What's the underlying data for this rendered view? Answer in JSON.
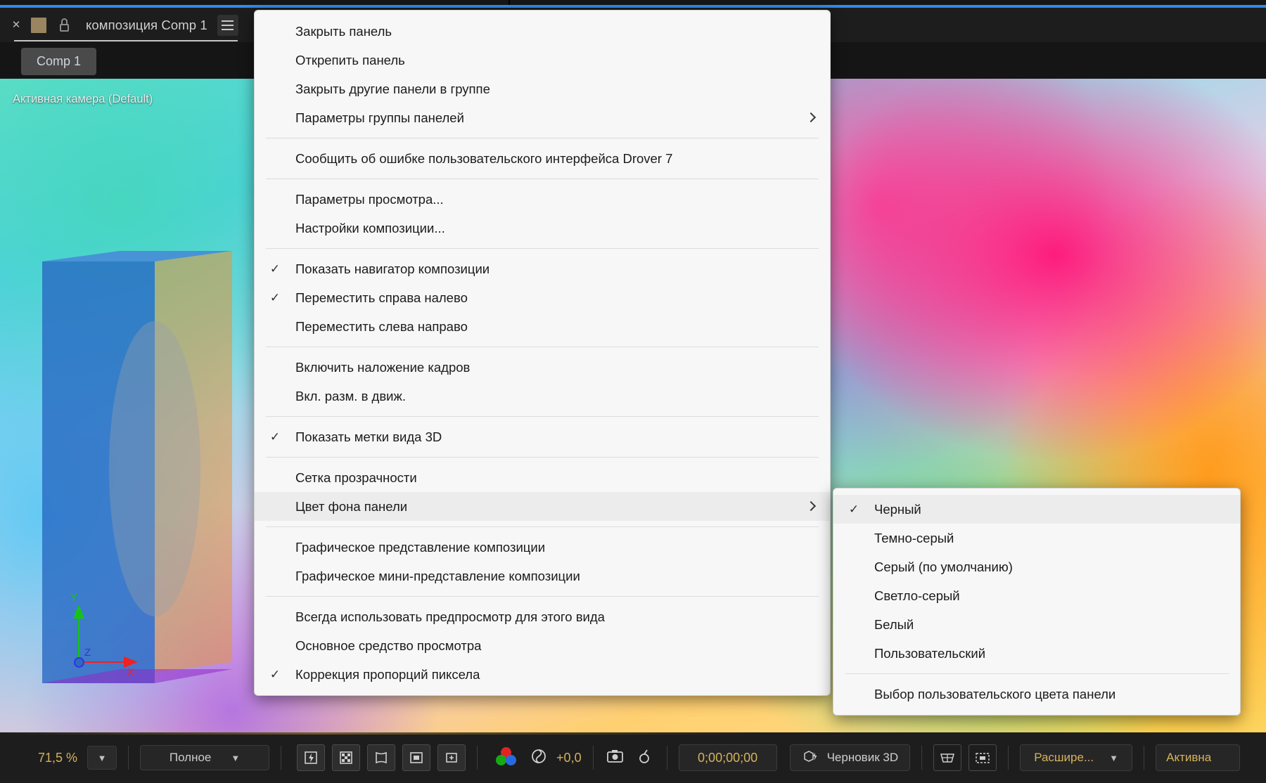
{
  "panel": {
    "title": "композиция Comp 1",
    "close_icon": "close-x",
    "swatch_icon": "color-swatch",
    "lock_icon": "lock",
    "menu_icon": "hamburger-menu",
    "tab_label": "Comp 1",
    "camera_label": "Активная камера (Default)",
    "accent_color": "#2d8ceb"
  },
  "gizmo": {
    "x": "X",
    "y": "Y",
    "z": "Z",
    "swirl": "↷"
  },
  "context_menu": {
    "groups": [
      {
        "items": [
          {
            "label": "Закрыть панель",
            "checked": false,
            "submenu": false
          },
          {
            "label": "Открепить панель",
            "checked": false,
            "submenu": false
          },
          {
            "label": "Закрыть другие панели в группе",
            "checked": false,
            "submenu": false
          },
          {
            "label": "Параметры группы панелей",
            "checked": false,
            "submenu": true
          }
        ]
      },
      {
        "items": [
          {
            "label": "Сообщить об ошибке пользовательского интерфейса Drover 7",
            "checked": false,
            "submenu": false
          }
        ]
      },
      {
        "items": [
          {
            "label": "Параметры просмотра...",
            "checked": false,
            "submenu": false
          },
          {
            "label": "Настройки композиции...",
            "checked": false,
            "submenu": false
          }
        ]
      },
      {
        "items": [
          {
            "label": "Показать навигатор композиции",
            "checked": true,
            "submenu": false
          },
          {
            "label": "Переместить справа налево",
            "checked": true,
            "submenu": false
          },
          {
            "label": "Переместить слева направо",
            "checked": false,
            "submenu": false
          }
        ]
      },
      {
        "items": [
          {
            "label": "Включить наложение кадров",
            "checked": false,
            "submenu": false
          },
          {
            "label": "Вкл. разм. в движ.",
            "checked": false,
            "submenu": false
          }
        ]
      },
      {
        "items": [
          {
            "label": "Показать метки вида 3D",
            "checked": true,
            "submenu": false
          }
        ]
      },
      {
        "items": [
          {
            "label": "Сетка прозрачности",
            "checked": false,
            "submenu": false
          },
          {
            "label": "Цвет фона панели",
            "checked": false,
            "submenu": true,
            "selected": true
          }
        ]
      },
      {
        "items": [
          {
            "label": "Графическое представление композиции",
            "checked": false,
            "submenu": false
          },
          {
            "label": "Графическое мини-представление композиции",
            "checked": false,
            "submenu": false
          }
        ]
      },
      {
        "items": [
          {
            "label": "Всегда использовать предпросмотр для этого вида",
            "checked": false,
            "submenu": false
          },
          {
            "label": "Основное средство просмотра",
            "checked": false,
            "submenu": false
          },
          {
            "label": "Коррекция пропорций пиксела",
            "checked": true,
            "submenu": false
          }
        ]
      }
    ]
  },
  "sub_menu": {
    "groups": [
      {
        "items": [
          {
            "label": "Черный",
            "checked": true,
            "selected": true
          },
          {
            "label": "Темно-серый",
            "checked": false
          },
          {
            "label": "Серый (по умолчанию)",
            "checked": false
          },
          {
            "label": "Светло-серый",
            "checked": false
          },
          {
            "label": "Белый",
            "checked": false
          },
          {
            "label": "Пользовательский",
            "checked": false
          }
        ]
      },
      {
        "items": [
          {
            "label": "Выбор пользовательского цвета панели",
            "checked": false
          }
        ]
      }
    ]
  },
  "toolbar": {
    "zoom": "71,5 %",
    "zoom_caret_icon": "chevron-down-icon",
    "resolution": "Полное",
    "resolution_caret_icon": "chevron-down-icon",
    "fast_preview_icon": "fast-preview-icon",
    "transparency_grid_icon": "transparency-grid-icon",
    "region_of_interest_icon": "region-of-interest-icon",
    "mask_path_icon": "mask-path-icon",
    "toggle_masks_icon": "toggle-masks-icon",
    "channels_icon": "rgb-channels-icon",
    "exposure_icon": "exposure-icon",
    "exposure_value": "+0,0",
    "timecode": "0;00;00;00",
    "snapshot_icon": "camera-snapshot-icon",
    "show_snapshot_icon": "show-snapshot-icon",
    "draft3d_icon": "draft-3d-icon",
    "draft3d_label": "Черновик 3D",
    "grid_icon": "grid-guides-icon",
    "region_icon": "region-icon",
    "view_layout": "Расшире...",
    "view_layout_caret_icon": "chevron-down-icon",
    "camera_view": "Активна"
  }
}
